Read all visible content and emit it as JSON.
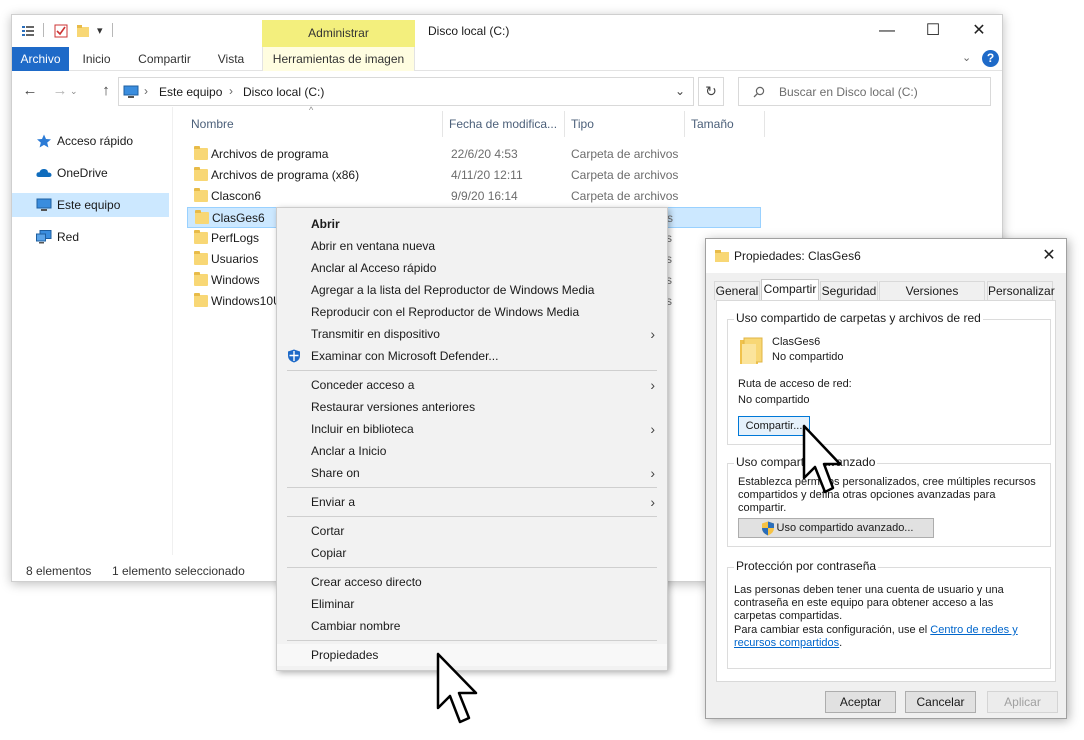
{
  "explorer": {
    "window_title": "Disco local (C:)",
    "context_tab_header": "Administrar",
    "ribbon_tabs": [
      "Archivo",
      "Inicio",
      "Compartir",
      "Vista",
      "Herramientas de imagen"
    ],
    "breadcrumb": [
      "Este equipo",
      "Disco local (C:)"
    ],
    "search_placeholder": "Buscar en Disco local (C:)",
    "nav_items": [
      {
        "label": "Acceso rápido",
        "icon": "star-icon"
      },
      {
        "label": "OneDrive",
        "icon": "cloud-icon"
      },
      {
        "label": "Este equipo",
        "icon": "computer-icon"
      },
      {
        "label": "Red",
        "icon": "network-icon"
      }
    ],
    "columns": [
      "Nombre",
      "Fecha de modifica...",
      "Tipo",
      "Tamaño"
    ],
    "files": [
      {
        "name": "Archivos de programa",
        "date": "22/6/20 4:53",
        "type": "Carpeta de archivos"
      },
      {
        "name": "Archivos de programa (x86)",
        "date": "4/11/20 12:11",
        "type": "Carpeta de archivos"
      },
      {
        "name": "Clascon6",
        "date": "9/9/20 16:14",
        "type": "Carpeta de archivos"
      },
      {
        "name": "ClasGes6",
        "date": "",
        "type": "s"
      },
      {
        "name": "PerfLogs",
        "date": "",
        "type": "s"
      },
      {
        "name": "Usuarios",
        "date": "",
        "type": "s"
      },
      {
        "name": "Windows",
        "date": "",
        "type": "s"
      },
      {
        "name": "Windows10U",
        "date": "",
        "type": "s"
      }
    ],
    "status_count": "8 elementos",
    "status_selected": "1 elemento seleccionado"
  },
  "context_menu": {
    "items": [
      "Abrir",
      "Abrir en ventana nueva",
      "Anclar al Acceso rápido",
      "Agregar a la lista del Reproductor de Windows Media",
      "Reproducir con el Reproductor de Windows Media",
      "Transmitir en dispositivo",
      "Examinar con Microsoft Defender...",
      "Conceder acceso a",
      "Restaurar versiones anteriores",
      "Incluir en biblioteca",
      "Anclar a Inicio",
      "Share on",
      "Enviar a",
      "Cortar",
      "Copiar",
      "Crear acceso directo",
      "Eliminar",
      "Cambiar nombre",
      "Propiedades"
    ]
  },
  "properties": {
    "title": "Propiedades: ClasGes6",
    "tabs": [
      "General",
      "Compartir",
      "Seguridad",
      "Versiones anteriores",
      "Personalizar"
    ],
    "group1_label": "Uso compartido de carpetas y archivos de red",
    "folder_name": "ClasGes6",
    "share_state": "No compartido",
    "path_label": "Ruta de acceso de red:",
    "path_value": "No compartido",
    "share_button": "Compartir...",
    "group2_label": "Uso compartido avanzado",
    "group2_text": "Establezca permisos personalizados, cree múltiples recursos compartidos y defina otras opciones avanzadas para compartir.",
    "advanced_button": "Uso compartido avanzado...",
    "group3_label": "Protección por contraseña",
    "group3_text": "Las personas deben tener una cuenta de usuario y una contraseña en este equipo para obtener acceso a las carpetas compartidas.",
    "group3_text2": "Para cambiar esta configuración, use el",
    "group3_link": "Centro de redes y recursos compartidos",
    "buttons": [
      "Aceptar",
      "Cancelar",
      "Aplicar"
    ]
  }
}
